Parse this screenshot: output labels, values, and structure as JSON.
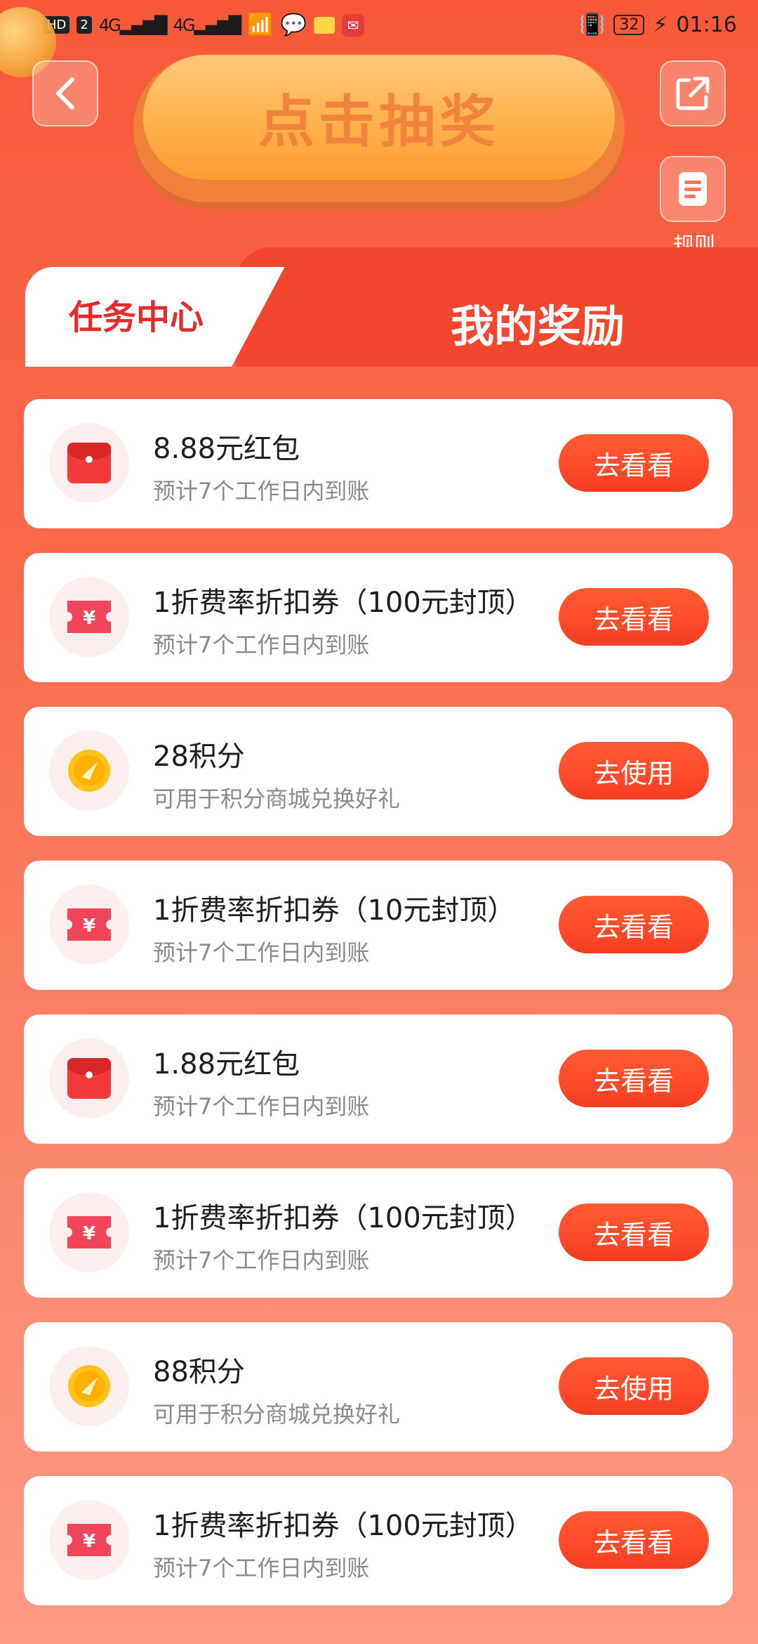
{
  "status_bar": {
    "left_badges": [
      "HD",
      "2"
    ],
    "network_1": "4G",
    "network_2": "4G",
    "battery": "32",
    "time": "01:16"
  },
  "header": {
    "draw_button": "点击抽奖",
    "rules_label": "规则"
  },
  "tabs": {
    "task_center": "任务中心",
    "my_rewards": "我的奖励"
  },
  "rewards": [
    {
      "icon": "red-envelope-icon",
      "title": "8.88元红包",
      "subtitle": "预计7个工作日内到账",
      "action": "去看看"
    },
    {
      "icon": "coupon-icon",
      "title": "1折费率折扣券（100元封顶）",
      "subtitle": "预计7个工作日内到账",
      "action": "去看看"
    },
    {
      "icon": "points-coin-icon",
      "title": "28积分",
      "subtitle": "可用于积分商城兑换好礼",
      "action": "去使用"
    },
    {
      "icon": "coupon-icon",
      "title": "1折费率折扣券（10元封顶）",
      "subtitle": "预计7个工作日内到账",
      "action": "去看看"
    },
    {
      "icon": "red-envelope-icon",
      "title": "1.88元红包",
      "subtitle": "预计7个工作日内到账",
      "action": "去看看"
    },
    {
      "icon": "coupon-icon",
      "title": "1折费率折扣券（100元封顶）",
      "subtitle": "预计7个工作日内到账",
      "action": "去看看"
    },
    {
      "icon": "points-coin-icon",
      "title": "88积分",
      "subtitle": "可用于积分商城兑换好礼",
      "action": "去使用"
    },
    {
      "icon": "coupon-icon",
      "title": "1折费率折扣券（100元封顶）",
      "subtitle": "预计7个工作日内到账",
      "action": "去看看"
    }
  ],
  "colors": {
    "accent": "#f2472e",
    "action_button": "#ff4a2a",
    "task_tab_text": "#e32d2d"
  }
}
